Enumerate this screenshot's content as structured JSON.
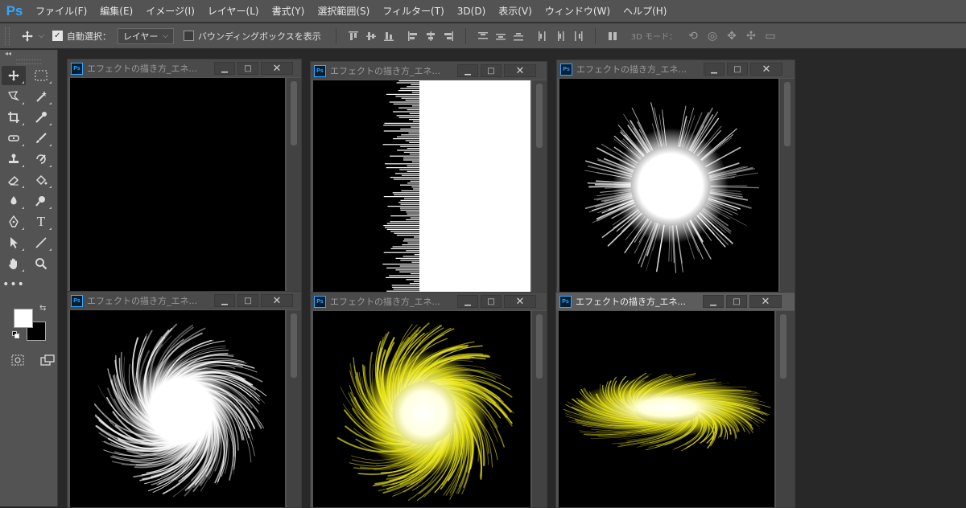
{
  "app": {
    "logo": "Ps"
  },
  "menu": [
    "ファイル(F)",
    "編集(E)",
    "イメージ(I)",
    "レイヤー(L)",
    "書式(Y)",
    "選択範囲(S)",
    "フィルター(T)",
    "3D(D)",
    "表示(V)",
    "ウィンドウ(W)",
    "ヘルプ(H)"
  ],
  "options": {
    "auto_select_checked": true,
    "auto_select_label": "自動選択：",
    "auto_select_target": "レイヤー",
    "bounding_box_checked": false,
    "bounding_box_label": "バウンディングボックスを表示",
    "mode_3d_label": "3D モード："
  },
  "colors": {
    "foreground": "#ffffff",
    "background": "#000000",
    "brand": "#31a8ff",
    "effect_yellow": "#f2ef1d"
  },
  "documents": [
    {
      "title": "エフェクトの描き方_エネ...",
      "badge": "Ps",
      "active": false,
      "content": "black"
    },
    {
      "title": "エフェクトの描き方_エネ...",
      "badge": "Ps",
      "active": false,
      "content": "noise-edge"
    },
    {
      "title": "エフェクトの描き方_エネ...",
      "badge": "Ps",
      "active": false,
      "content": "radial-white"
    },
    {
      "title": "エフェクトの描き方_エネ...",
      "badge": "Ps",
      "active": false,
      "content": "twirl-white"
    },
    {
      "title": "エフェクトの描き方_エネ...",
      "badge": "Ps",
      "active": false,
      "content": "twirl-yellow"
    },
    {
      "title": "エフェクトの描き方_エネ...",
      "badge": "Ps",
      "active": true,
      "content": "ellipse-yellow"
    }
  ],
  "window_buttons": {
    "minimize": "▁",
    "maximize": "□",
    "close": "✕"
  }
}
